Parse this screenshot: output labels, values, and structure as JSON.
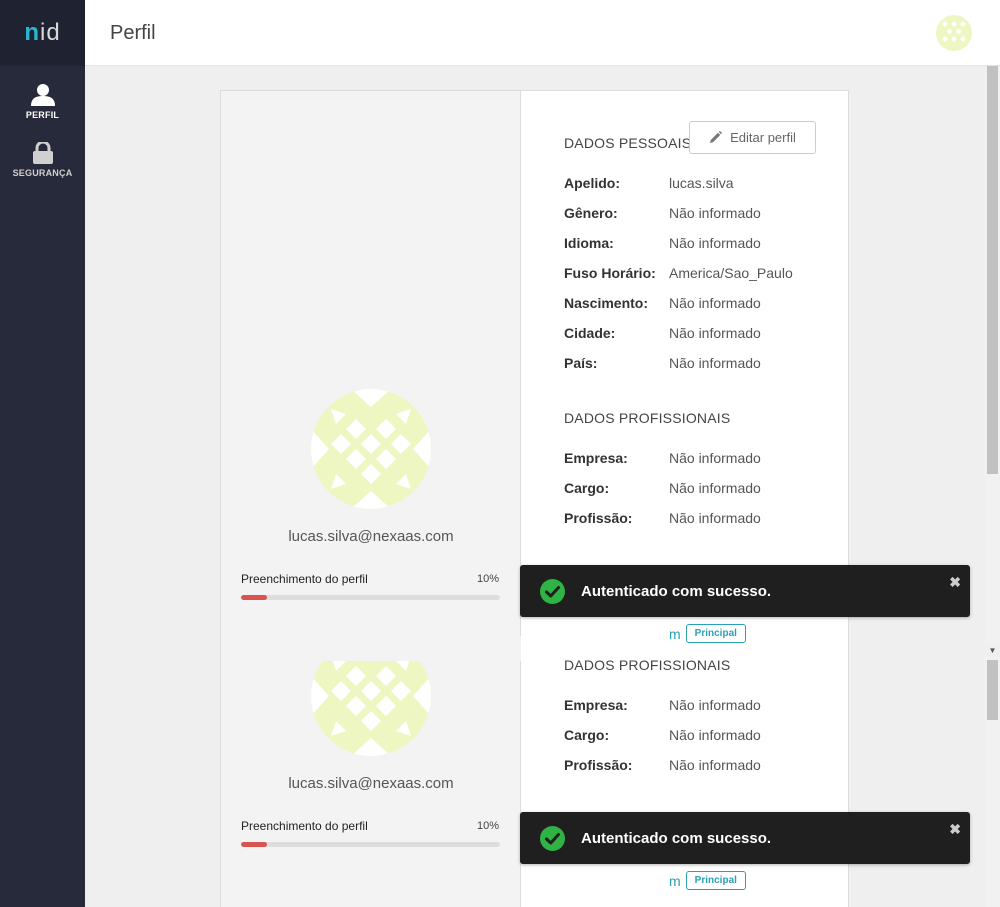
{
  "app": {
    "logo_n": "n",
    "logo_rest": "id"
  },
  "sidebar": {
    "items": [
      {
        "label": "PERFIL",
        "icon": "user-icon"
      },
      {
        "label": "SEGURANÇA",
        "icon": "lock-icon"
      }
    ]
  },
  "header": {
    "title": "Perfil"
  },
  "profile": {
    "email": "lucas.silva@nexaas.com",
    "progress_label": "Preenchimento do perfil",
    "progress_value": "10%",
    "progress_fraction": 0.1
  },
  "personal": {
    "title": "DADOS PESSOAIS",
    "edit_label": "Editar perfil",
    "fields": [
      {
        "label": "Apelido:",
        "value": "lucas.silva"
      },
      {
        "label": "Gênero:",
        "value": "Não informado"
      },
      {
        "label": "Idioma:",
        "value": "Não informado"
      },
      {
        "label": "Fuso Horário:",
        "value": "America/Sao_Paulo"
      },
      {
        "label": "Nascimento:",
        "value": "Não informado"
      },
      {
        "label": "Cidade:",
        "value": "Não informado"
      },
      {
        "label": "País:",
        "value": "Não informado"
      }
    ]
  },
  "professional": {
    "title": "DADOS PROFISSIONAIS",
    "fields": [
      {
        "label": "Empresa:",
        "value": "Não informado"
      },
      {
        "label": "Cargo:",
        "value": "Não informado"
      },
      {
        "label": "Profissão:",
        "value": "Não informado"
      }
    ]
  },
  "email_badge": {
    "partial": "m",
    "label": "Principal"
  },
  "toast": {
    "message": "Autenticado com sucesso.",
    "close": "✖"
  },
  "colors": {
    "accent": "#2a9fb8",
    "progress": "#d9534f",
    "sidebar": "#272a3a",
    "avatar": "#eef7c2"
  }
}
